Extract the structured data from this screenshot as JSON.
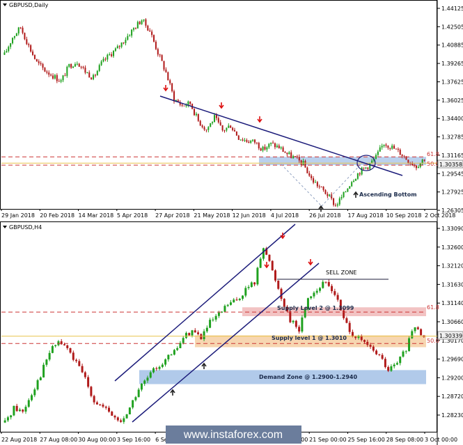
{
  "chart_data": [
    {
      "type": "candlestick",
      "title": "GBPUSD,Daily",
      "ylim": [
        1.262,
        1.448
      ],
      "y_ticks": [
        "1.44125",
        "1.42505",
        "1.40885",
        "1.39265",
        "1.37625",
        "1.36025",
        "1.34400",
        "1.32785",
        "1.31165",
        "1.29545",
        "1.27925",
        "1.26305"
      ],
      "x_ticks": [
        "29 Jan 2018",
        "20 Feb 2018",
        "14 Mar 2018",
        "5 Apr 2018",
        "27 Apr 2018",
        "21 May 2018",
        "12 Jun 2018",
        "4 Jul 2018",
        "26 Jul 2018",
        "17 Aug 2018",
        "10 Sep 2018",
        "2 Oct 2018"
      ],
      "close_series": [
        1.402,
        1.418,
        1.427,
        1.41,
        1.395,
        1.388,
        1.383,
        1.378,
        1.392,
        1.396,
        1.387,
        1.381,
        1.394,
        1.402,
        1.408,
        1.417,
        1.426,
        1.434,
        1.424,
        1.404,
        1.386,
        1.362,
        1.356,
        1.358,
        1.342,
        1.334,
        1.345,
        1.333,
        1.338,
        1.327,
        1.324,
        1.323,
        1.316,
        1.321,
        1.318,
        1.312,
        1.308,
        1.303,
        1.289,
        1.282,
        1.275,
        1.265,
        1.275,
        1.288,
        1.296,
        1.301,
        1.309,
        1.322,
        1.318,
        1.313,
        1.306,
        1.301,
        1.308
      ],
      "current_price": "1.30358",
      "current_price_value": 1.30358,
      "fib_61_8_label": "61.8",
      "fib_61_8_value": 1.3093,
      "fib_50_label": "50.0",
      "fib_50_value": 1.3018,
      "annotation": "Ascending Bottom"
    },
    {
      "type": "candlestick",
      "title": "GBPUSD,H4",
      "ylim": [
        1.2775,
        1.3335
      ],
      "y_ticks": [
        "1.33090",
        "1.32600",
        "1.32120",
        "1.31630",
        "1.31140",
        "1.30660",
        "1.30170",
        "1.29690",
        "1.29200",
        "1.28720",
        "1.28230"
      ],
      "x_ticks": [
        "22 Aug 2018",
        "27 Aug 08:00",
        "30 Aug 00:00",
        "3 Sep 16:00",
        "6 Sep 08:00",
        "11 Sep 00:00",
        "13 Sep 16:00",
        "18 Sep 08:00",
        "21 Sep 00:00",
        "25 Sep 16:00",
        "28 Sep 08:00",
        "3 Oct 00:00"
      ],
      "close_series": [
        1.28,
        1.284,
        1.283,
        1.288,
        1.293,
        1.299,
        1.302,
        1.3,
        1.296,
        1.292,
        1.286,
        1.284,
        1.282,
        1.28,
        1.284,
        1.289,
        1.292,
        1.295,
        1.297,
        1.299,
        1.303,
        1.305,
        1.303,
        1.307,
        1.309,
        1.312,
        1.313,
        1.316,
        1.318,
        1.328,
        1.321,
        1.314,
        1.308,
        1.305,
        1.314,
        1.316,
        1.318,
        1.315,
        1.308,
        1.304,
        1.302,
        1.3,
        1.298,
        1.294,
        1.296,
        1.3,
        1.306,
        1.303
      ],
      "current_price": "1.30339",
      "current_price_value": 1.30339,
      "fib_61_8_label": "61.8",
      "fib_61_8_value": 1.3099,
      "fib_50_label": "50.0",
      "fib_50_value": 1.3014,
      "sell_zone_label": "SELL ZONE",
      "sell_zone_value": 1.3188,
      "supply2_label": "Supply Level 2 @ 1.3099",
      "supply2_range": [
        1.3088,
        1.3112
      ],
      "supply1_label": "Supply level 1 @ 1.3010",
      "supply1_range": [
        1.3004,
        1.3036
      ],
      "demand_label": "Demand Zone @ 1.2900-1.2940",
      "demand_range": [
        1.2904,
        1.2942
      ]
    }
  ],
  "watermark": "www.instaforex.com",
  "colors": {
    "bull": "#1fa11f",
    "bear": "#b01a1a",
    "trendline": "#1b1b7a",
    "price_line": "#e8c34a",
    "fib_dash": "#cc3333",
    "zone_blue": "#a9c4e8",
    "zone_red": "#f0b8b8",
    "zone_orange": "#f6cfa3",
    "marker_red": "#dd1111"
  }
}
